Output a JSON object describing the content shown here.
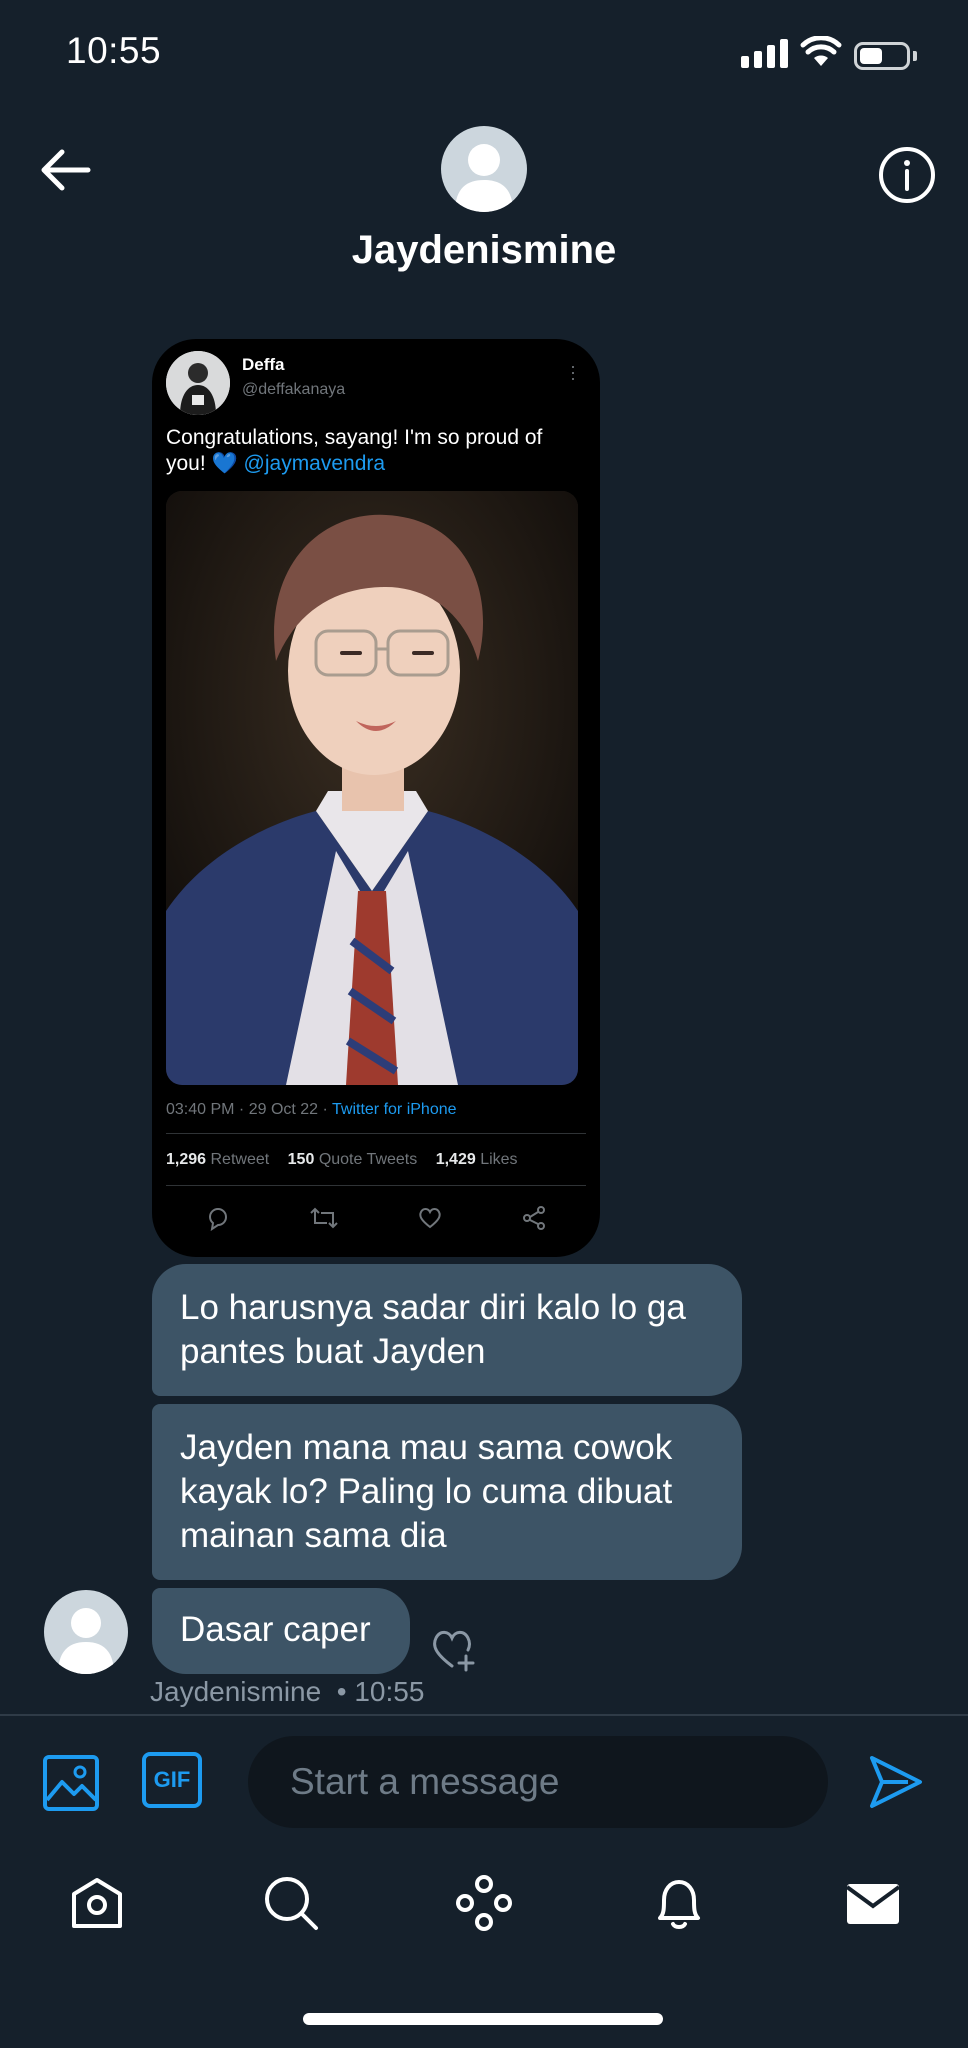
{
  "status": {
    "time": "10:55"
  },
  "header": {
    "title": "Jaydenismine"
  },
  "tweet": {
    "name": "Deffa",
    "handle": "@deffakanaya",
    "text": "Congratulations, sayang! I'm so proud of you! ",
    "emoji": "💙",
    "mention": "@jaymavendra",
    "time": "03:40 PM · 29 Oct 22 · ",
    "source": "Twitter for iPhone",
    "retweets": "1,296",
    "retweets_label": "Retweet",
    "quotes": "150",
    "quotes_label": "Quote Tweets",
    "likes": "1,429",
    "likes_label": "Likes"
  },
  "messages": [
    {
      "text": "Lo harusnya sadar diri kalo lo ga pantes buat Jayden"
    },
    {
      "text": "Jayden mana mau sama cowok kayak lo? Paling lo cuma dibuat mainan sama dia"
    },
    {
      "text": "Dasar caper"
    }
  ],
  "message_meta": {
    "sender": "Jaydenismine",
    "time": "• 10:55"
  },
  "composer": {
    "placeholder": "Start a message",
    "gif_label": "GIF"
  },
  "colors": {
    "background": "#15202b",
    "bubble": "#3d5466",
    "accent": "#1d9bf0"
  },
  "icons": {
    "back": "arrow-left-icon",
    "info": "info-icon",
    "media": "image-icon",
    "send": "send-icon",
    "tabs": [
      "home-icon",
      "search-icon",
      "spaces-icon",
      "bell-icon",
      "mail-icon"
    ]
  }
}
